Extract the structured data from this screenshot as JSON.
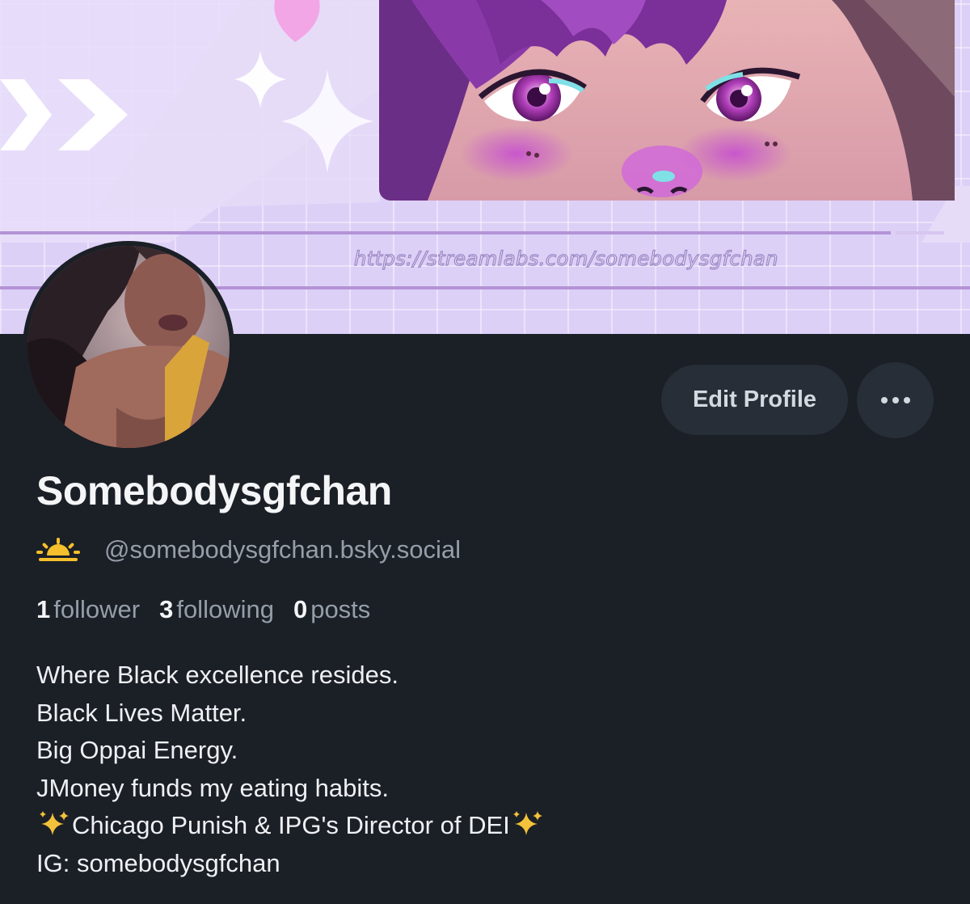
{
  "banner": {
    "link_text": "https://streamlabs.com/somebodysgfchan"
  },
  "profile": {
    "display_name": "Somebodysgfchan",
    "handle": "@somebodysgfchan.bsky.social",
    "handle_icon": "sunrise-icon"
  },
  "actions": {
    "edit_label": "Edit Profile",
    "more_icon": "more-options-icon"
  },
  "stats": {
    "followers_count": "1",
    "followers_label": "follower",
    "following_count": "3",
    "following_label": "following",
    "posts_count": "0",
    "posts_label": "posts"
  },
  "bio": {
    "line1": "Where Black excellence resides.",
    "line2": "Black Lives Matter.",
    "line3": "Big Oppai Energy.",
    "line4": "JMoney funds my eating habits.",
    "line5": "Chicago Punish & IPG's Director of DEI",
    "line6": "IG: somebodysgfchan"
  },
  "colors": {
    "background": "#1b1f26",
    "button_bg": "#272e38",
    "banner_bg": "#ddd0f7",
    "muted_text": "#959ea9"
  }
}
